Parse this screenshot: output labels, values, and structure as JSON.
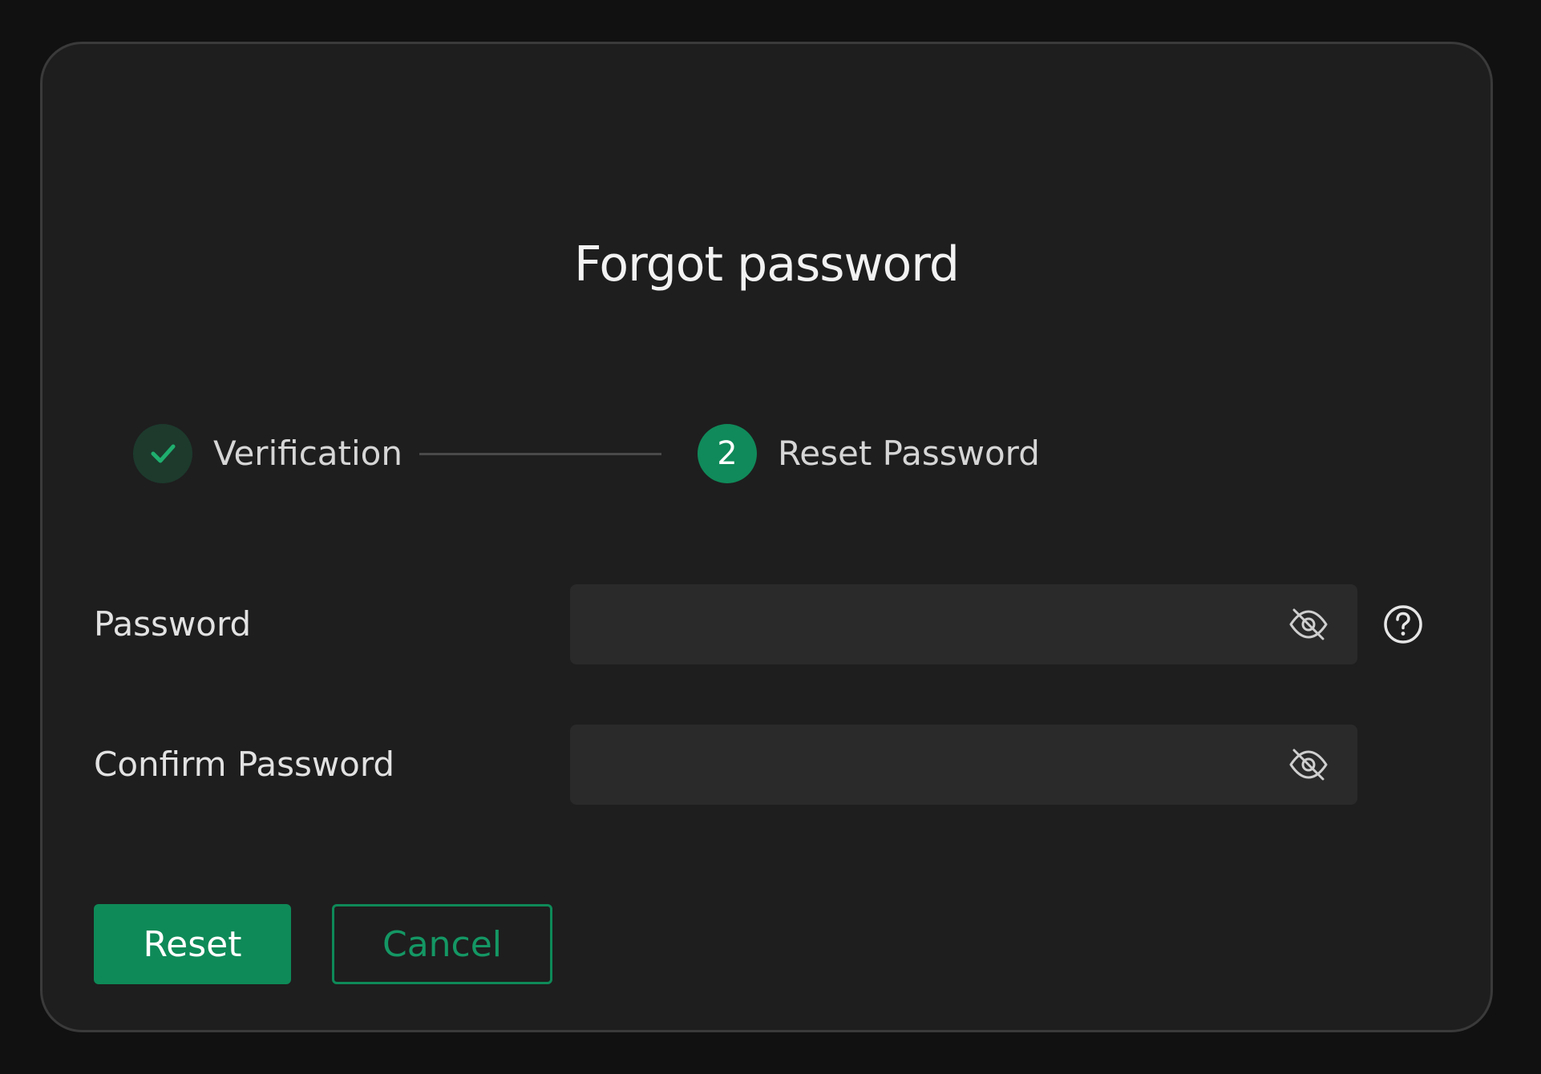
{
  "dialog": {
    "title": "Forgot password"
  },
  "steps": [
    {
      "label": "Verification",
      "status": "completed",
      "icon": "checkmark-icon"
    },
    {
      "number": "2",
      "label": "Reset Password",
      "status": "active"
    }
  ],
  "form": {
    "password": {
      "label": "Password",
      "value": "",
      "placeholder": "",
      "visibility_icon": "eye-slash-icon",
      "help_icon": "question-circle-icon"
    },
    "confirm_password": {
      "label": "Confirm Password",
      "value": "",
      "placeholder": "",
      "visibility_icon": "eye-slash-icon"
    }
  },
  "actions": {
    "reset_label": "Reset",
    "cancel_label": "Cancel"
  },
  "colors": {
    "accent": "#0e8a58",
    "background": "#111111",
    "dialog_background": "#1e1e1e",
    "input_background": "#2a2a2a",
    "completed_step": "#1d3a2d",
    "check": "#1fae6e"
  }
}
